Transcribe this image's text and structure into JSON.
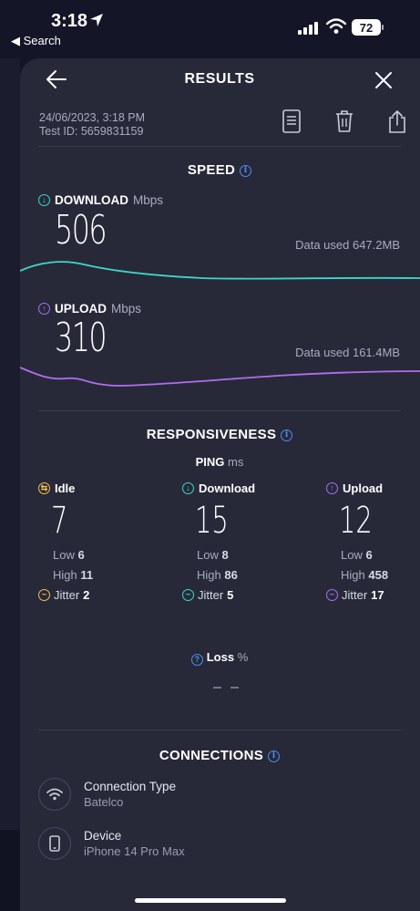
{
  "status": {
    "time": "3:18",
    "back_label": "◀ Search",
    "battery": "72"
  },
  "header": {
    "title": "RESULTS"
  },
  "meta": {
    "date": "24/06/2023, 3:18 PM",
    "test_id": "Test ID: 5659831159"
  },
  "speed": {
    "title": "SPEED",
    "download": {
      "label": "DOWNLOAD",
      "unit": "Mbps",
      "value": "506",
      "data_used": "Data used 647.2MB",
      "color": "#3fd6c8"
    },
    "upload": {
      "label": "UPLOAD",
      "unit": "Mbps",
      "value": "310",
      "data_used": "Data used 161.4MB",
      "color": "#b26cf0"
    }
  },
  "responsiveness": {
    "title": "RESPONSIVENESS",
    "ping_label": "PING",
    "ping_unit": "ms",
    "columns": [
      {
        "label": "Idle",
        "value": "7",
        "low_label": "Low",
        "low": "6",
        "high_label": "High",
        "high": "11",
        "jitter_label": "Jitter",
        "jitter": "2",
        "color": "#f2c14e"
      },
      {
        "label": "Download",
        "value": "15",
        "low_label": "Low",
        "low": "8",
        "high_label": "High",
        "high": "86",
        "jitter_label": "Jitter",
        "jitter": "5",
        "color": "#3fd6c8"
      },
      {
        "label": "Upload",
        "value": "12",
        "low_label": "Low",
        "low": "6",
        "high_label": "High",
        "high": "458",
        "jitter_label": "Jitter",
        "jitter": "17",
        "color": "#b26cf0"
      }
    ],
    "loss_label": "Loss",
    "loss_unit": "%",
    "loss_value": "– –"
  },
  "connections": {
    "title": "CONNECTIONS",
    "items": [
      {
        "title": "Connection Type",
        "value": "Batelco",
        "icon": "wifi-icon"
      },
      {
        "title": "Device",
        "value": "iPhone 14 Pro Max",
        "icon": "phone-icon"
      }
    ]
  }
}
